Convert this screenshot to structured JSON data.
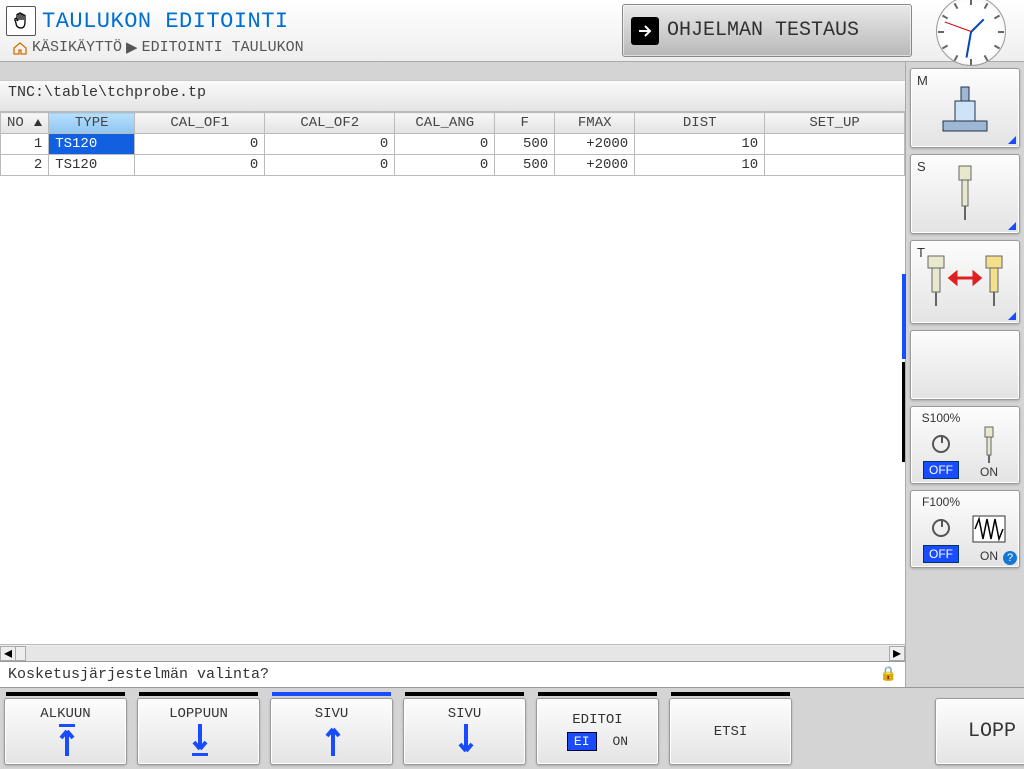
{
  "header": {
    "title": "TAULUKON EDITOINTI",
    "breadcrumb_a": "KÄSIKÄYTTÖ",
    "breadcrumb_b": "EDITOINTI TAULUKON",
    "mode_button": "OHJELMAN TESTAUS"
  },
  "path": "TNC:\\table\\tchprobe.tp",
  "columns": [
    "NO",
    "TYPE",
    "CAL_OF1",
    "CAL_OF2",
    "CAL_ANG",
    "F",
    "FMAX",
    "DIST",
    "SET_UP"
  ],
  "rows": [
    {
      "no": "1",
      "type": "TS120",
      "cal_of1": "0",
      "cal_of2": "0",
      "cal_ang": "0",
      "f": "500",
      "fmax": "+2000",
      "dist": "10",
      "setup": ""
    },
    {
      "no": "2",
      "type": "TS120",
      "cal_of1": "0",
      "cal_of2": "0",
      "cal_ang": "0",
      "f": "500",
      "fmax": "+2000",
      "dist": "10",
      "setup": ""
    }
  ],
  "status": "Kosketusjärjestelmän valinta?",
  "softkeys": {
    "k1": "ALKUUN",
    "k2": "LOPPUUN",
    "k3": "SIVU",
    "k4": "SIVU",
    "k5": "EDITOI",
    "k5_off": "EI",
    "k5_on": "ON",
    "k6": "ETSI",
    "k8": "LOPP"
  },
  "sidebar": {
    "m": "M",
    "s": "S",
    "t": "T",
    "s100": "S100%",
    "s_off": "OFF",
    "s_on": "ON",
    "f100": "F100%",
    "f_off": "OFF",
    "f_on": "ON"
  }
}
